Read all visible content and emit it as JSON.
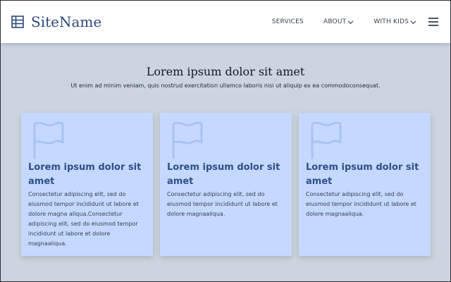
{
  "header": {
    "brand": "SiteName",
    "nav": [
      {
        "label": "SERVICES"
      },
      {
        "label": "ABOUT"
      },
      {
        "label": "WITH KIDS"
      }
    ],
    "icons": {
      "brand": "grid-icon",
      "menu": "hamburger-menu-icon",
      "dropdown": "chevron-down-icon"
    }
  },
  "hero": {
    "title": "Lorem ipsum dolor sit amet",
    "subtitle": "Ut enim ad minim veniam, quis nostrud exercitation ullamco laboris nisi ut aliquip ex ea commodoconsequat."
  },
  "cards": [
    {
      "icon": "flag-icon",
      "title": "Lorem ipsum dolor sit amet",
      "body": "Consectetur adipiscing elit, sed do eiusmod tempor incididunt ut labore et dolore magna aliqua.Consectetur adipiscing elit, sed do eiusmod tempor incididunt ut labore et dolore magnaaliqua."
    },
    {
      "icon": "flag-icon",
      "title": "Lorem ipsum dolor sit amet",
      "body": "Consectetur adipiscing elit, sed do eiusmod tempor incididunt ut labore et dolore magnaaliqua."
    },
    {
      "icon": "flag-icon",
      "title": "Lorem ipsum dolor sit amet",
      "body": "Consectetur adipiscing elit, sed do eiusmod tempor incididunt ut labore et dolore magnaaliqua."
    }
  ],
  "colors": {
    "background": "#ccd5df",
    "header": "#ffffff",
    "card": "#c5d8ff",
    "brand_text": "#2c4a7a",
    "card_title": "#2d4f86",
    "flag_stroke": "#a9c3f2"
  }
}
